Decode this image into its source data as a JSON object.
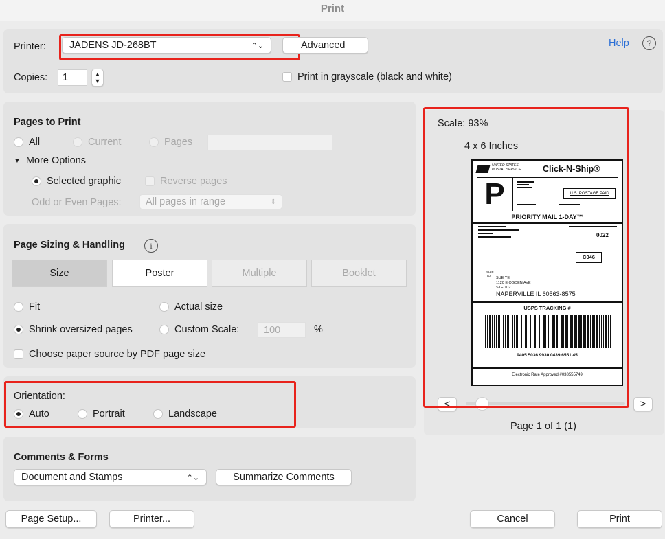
{
  "window": {
    "title": "Print"
  },
  "printer": {
    "label": "Printer:",
    "value": "JADENS JD-268BT",
    "advanced_label": "Advanced"
  },
  "help": {
    "link": "Help",
    "icon_text": "?"
  },
  "copies": {
    "label": "Copies:",
    "value": "1"
  },
  "grayscale": {
    "label": "Print in grayscale (black and white)"
  },
  "pages_to_print": {
    "title": "Pages to Print",
    "all": "All",
    "current": "Current",
    "pages": "Pages",
    "more_options": "More Options",
    "selected_graphic": "Selected graphic",
    "reverse_pages": "Reverse pages",
    "odd_even_label": "Odd or Even Pages:",
    "odd_even_value": "All pages in range"
  },
  "page_sizing": {
    "title": "Page Sizing & Handling",
    "info_icon": "i",
    "tabs": [
      "Size",
      "Poster",
      "Multiple",
      "Booklet"
    ],
    "fit": "Fit",
    "actual_size": "Actual size",
    "shrink": "Shrink oversized pages",
    "custom_scale": "Custom Scale:",
    "custom_scale_value": "100",
    "percent": "%",
    "paper_source": "Choose paper source by PDF page size"
  },
  "orientation": {
    "title": "Orientation:",
    "options": [
      "Auto",
      "Portrait",
      "Landscape"
    ],
    "selected": "Auto"
  },
  "comments_forms": {
    "title": "Comments & Forms",
    "value": "Document and Stamps",
    "summarize": "Summarize Comments"
  },
  "preview": {
    "scale": "Scale: 93%",
    "paper": "4 x 6 Inches",
    "page_info": "Page 1 of 1 (1)",
    "prev": "<",
    "next": ">"
  },
  "shipping_label": {
    "usps_top": "UNITED STATES",
    "usps_bottom": "POSTAL SERVICE",
    "brand": "Click-N-Ship®",
    "class_letter": "P",
    "postage_paid": "U.S. POSTAGE PAID",
    "service": "PRIORITY MAIL 1-DAY™",
    "route": "0022",
    "code": "C046",
    "ship_to": "SHIP TO:",
    "addr1": "SUE YE",
    "addr2": "1120 E OGDEN AVE",
    "addr3": "STE 102",
    "city": "NAPERVILLE IL 60563-8575",
    "tracking_title": "USPS TRACKING #",
    "tracking_number": "9405 5036 9930 0439 6551 45",
    "footer": "Electronic Rate Approved #038555749"
  },
  "footer": {
    "page_setup": "Page Setup...",
    "printer": "Printer...",
    "cancel": "Cancel",
    "print": "Print"
  }
}
